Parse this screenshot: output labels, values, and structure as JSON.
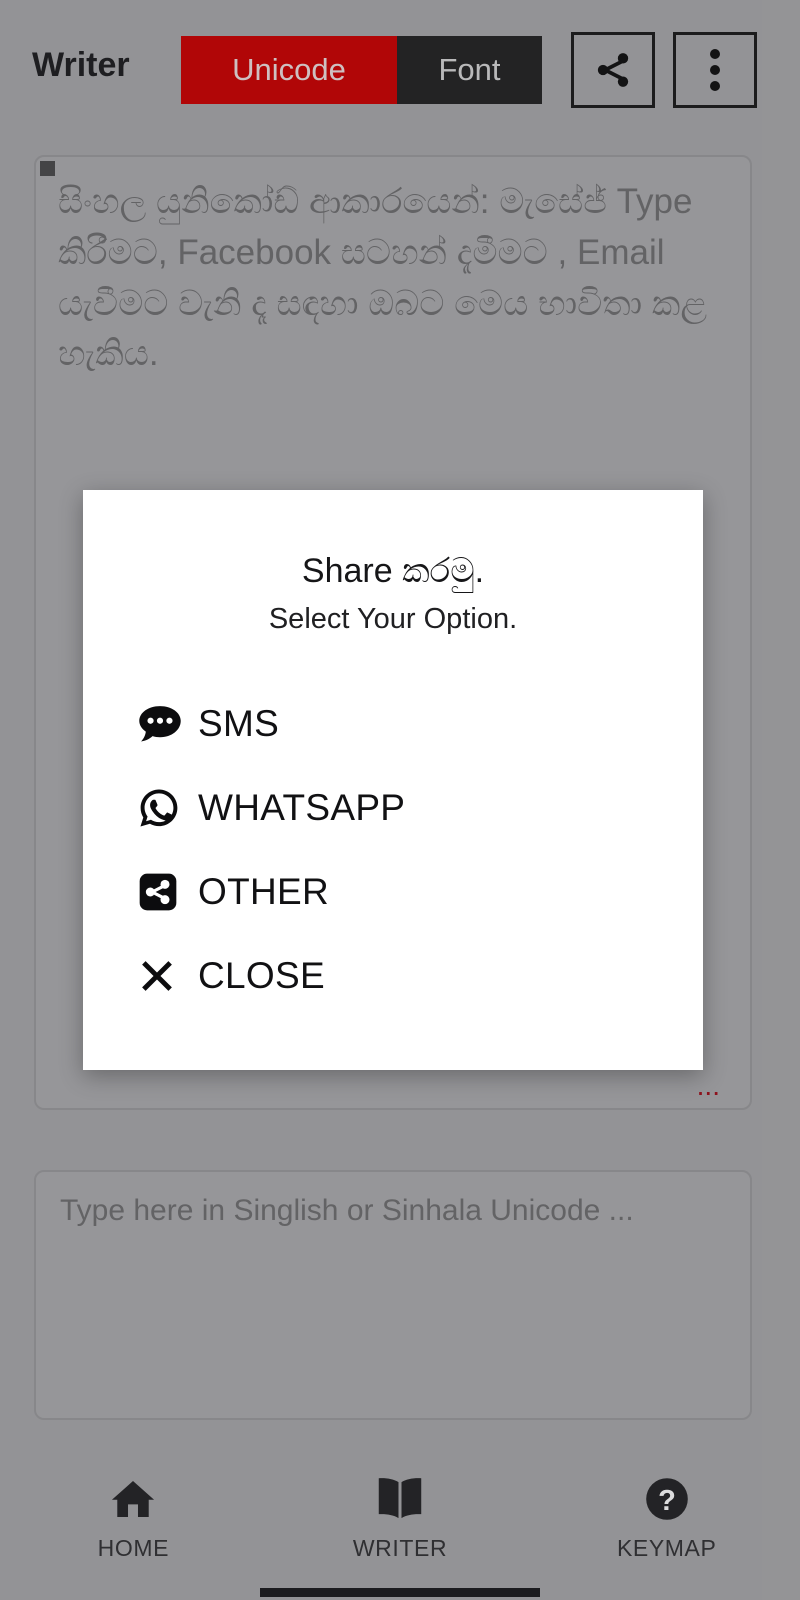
{
  "app": {
    "title": "Writer",
    "background_color": "#a9a9ab"
  },
  "toolbar": {
    "unicode_label": "Unicode",
    "font_label": "Font",
    "unicode_active": true,
    "unicode_color": "#cc0000",
    "font_color": "#232323",
    "share_icon": "share-icon",
    "overflow_icon": "more-vertical-icon"
  },
  "editor": {
    "content": "සිංහල යුනිකෝඩ් ආකාරයෙන්: මැසේජ් Type කිරීමට, Facebook සටහන් දැමීමට , Email යැවීමට වැනි දෑ සඳහා ඔබට මෙය භාවිතා කළ හැකිය.",
    "footnote": "..."
  },
  "input": {
    "placeholder": "Type here in Singlish or Sinhala Unicode ...",
    "value": ""
  },
  "dialog": {
    "title": "Share කරමු.",
    "subtitle": "Select Your Option.",
    "options": [
      {
        "label": "SMS",
        "icon": "comment-dots-icon"
      },
      {
        "label": "WHATSAPP",
        "icon": "whatsapp-icon"
      },
      {
        "label": "OTHER",
        "icon": "share-square-icon"
      },
      {
        "label": "CLOSE",
        "icon": "close-icon"
      }
    ]
  },
  "bottom_nav": {
    "items": [
      {
        "label": "HOME",
        "icon": "home-icon",
        "selected": false
      },
      {
        "label": "WRITER",
        "icon": "book-open-icon",
        "selected": true
      },
      {
        "label": "KEYMAP",
        "icon": "question-circle-icon",
        "selected": false
      }
    ]
  }
}
